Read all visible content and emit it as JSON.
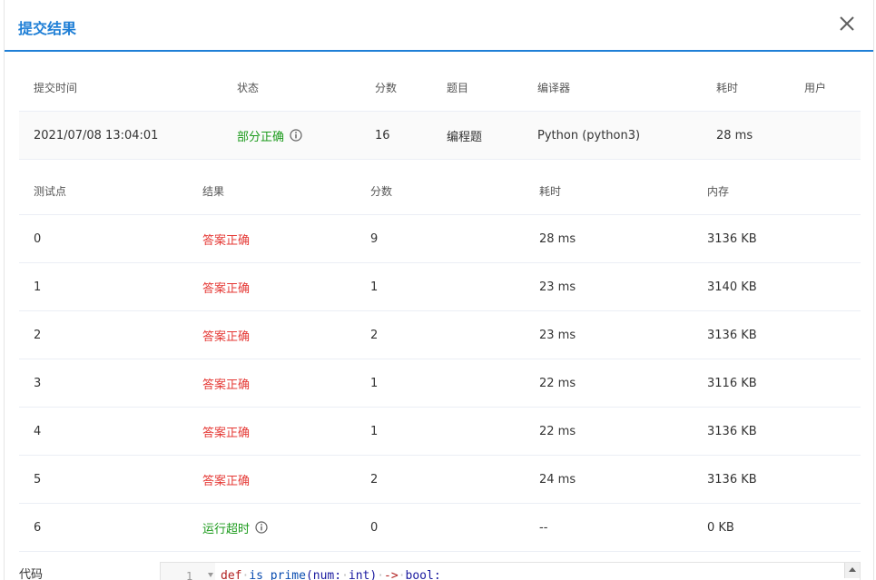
{
  "modal": {
    "title": "提交结果"
  },
  "summary": {
    "headers": [
      "提交时间",
      "状态",
      "分数",
      "题目",
      "编译器",
      "耗时",
      "用户"
    ],
    "row": {
      "time": "2021/07/08 13:04:01",
      "status": "部分正确",
      "score": "16",
      "problem": "编程题",
      "compiler": "Python (python3)",
      "duration": "28 ms",
      "user": ""
    }
  },
  "cases": {
    "headers": [
      "测试点",
      "结果",
      "分数",
      "耗时",
      "内存"
    ],
    "rows": [
      {
        "id": "0",
        "result": "答案正确",
        "score": "9",
        "time": "28 ms",
        "memory": "3136 KB"
      },
      {
        "id": "1",
        "result": "答案正确",
        "score": "1",
        "time": "23 ms",
        "memory": "3140 KB"
      },
      {
        "id": "2",
        "result": "答案正确",
        "score": "2",
        "time": "23 ms",
        "memory": "3136 KB"
      },
      {
        "id": "3",
        "result": "答案正确",
        "score": "1",
        "time": "22 ms",
        "memory": "3116 KB"
      },
      {
        "id": "4",
        "result": "答案正确",
        "score": "1",
        "time": "22 ms",
        "memory": "3136 KB"
      },
      {
        "id": "5",
        "result": "答案正确",
        "score": "2",
        "time": "24 ms",
        "memory": "3136 KB"
      },
      {
        "id": "6",
        "result": "运行超时",
        "score": "0",
        "time": "--",
        "memory": "0 KB"
      }
    ]
  },
  "code": {
    "label": "代码",
    "line_number": "1",
    "tokens": {
      "kw_def": "def",
      "fn_name": "is_prime",
      "params_open": "(num:",
      "type_int": "int",
      "params_close": ")",
      "arrow": "->",
      "type_bool": "bool",
      "colon": ":"
    }
  },
  "colors": {
    "accent": "#1f7fd6",
    "status_red": "#e53935",
    "status_green": "#1b9a1b"
  },
  "icons": {
    "close": "close-icon",
    "info": "info-icon",
    "fold": "fold-arrow-icon",
    "scroll": "scroll-up-arrow-icon"
  }
}
